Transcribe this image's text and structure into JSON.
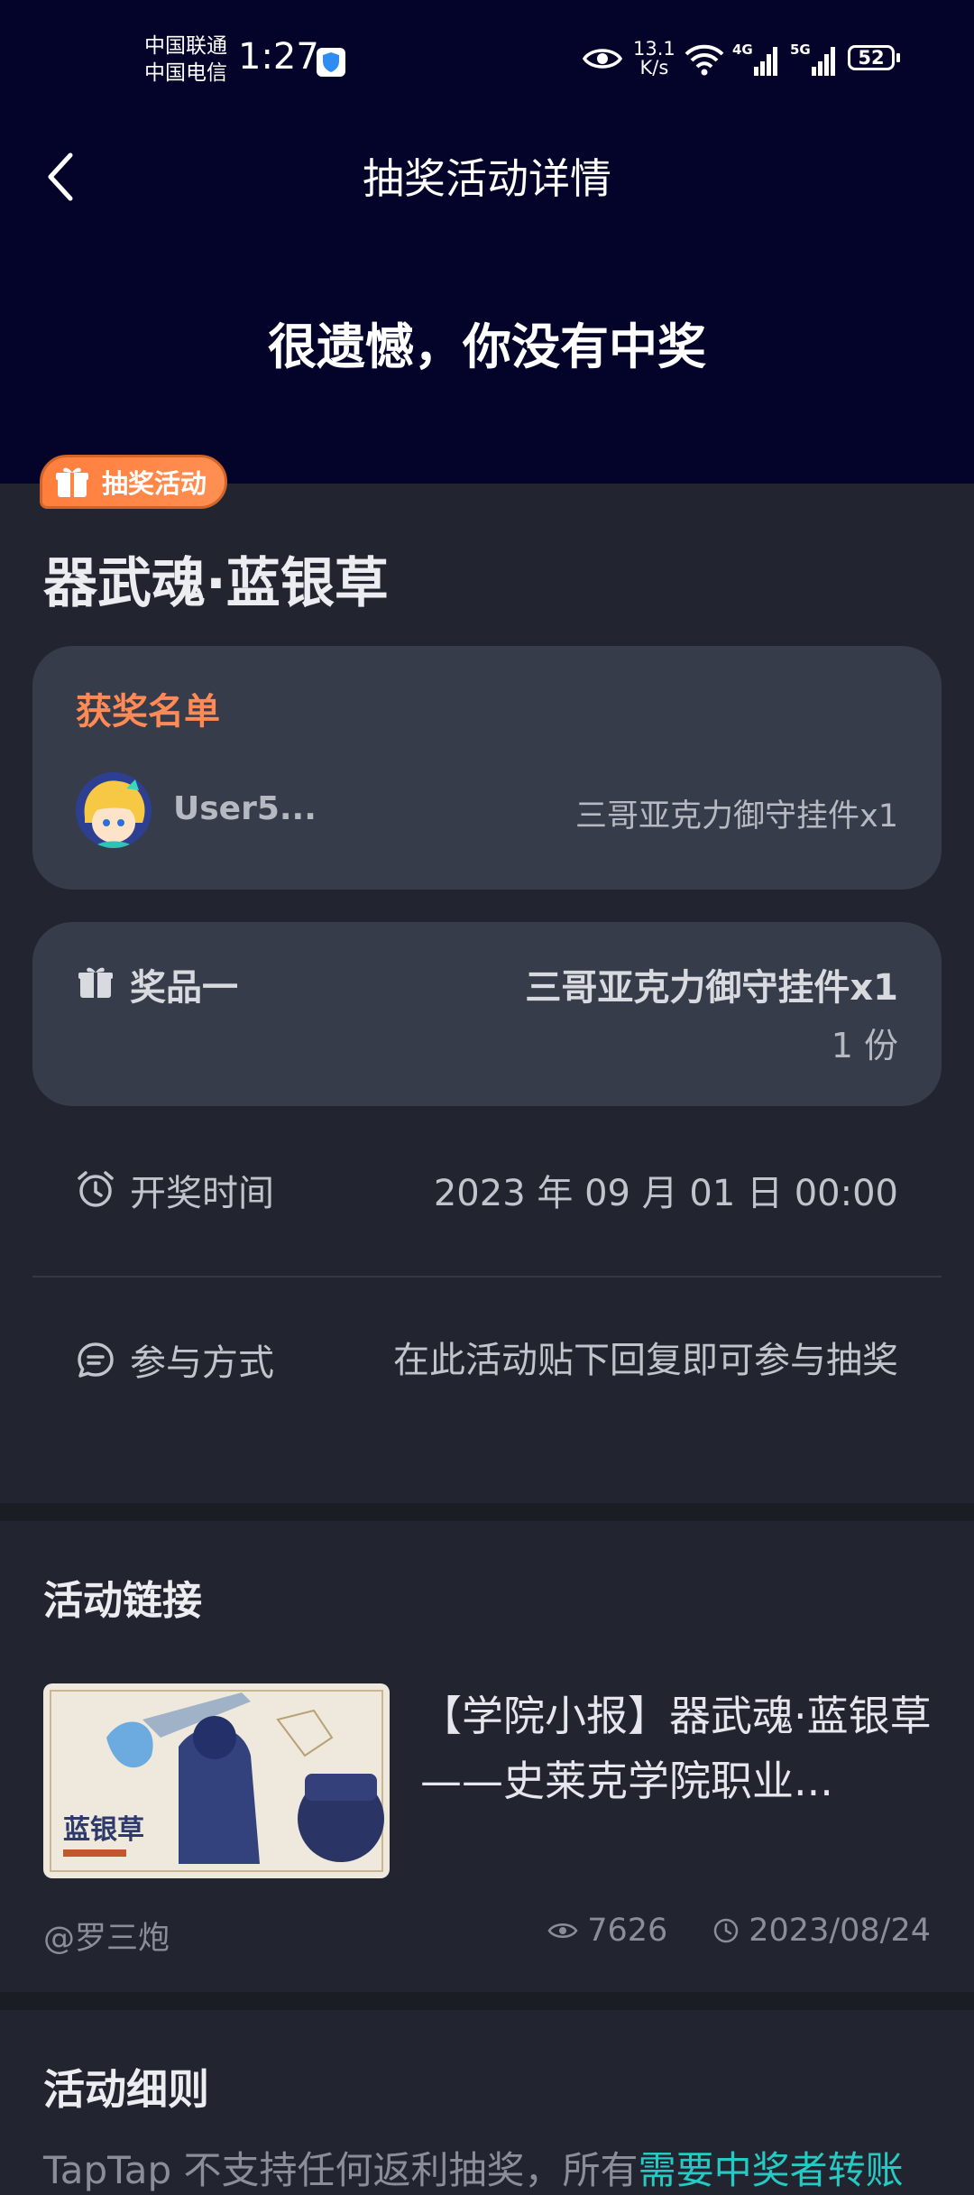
{
  "status_bar": {
    "carrier_1": "中国联通",
    "carrier_2": "中国电信",
    "time": "1:27",
    "net_speed_value": "13.1",
    "net_speed_unit": "K/s",
    "signal_1": "4G",
    "signal_2": "5G",
    "battery": "52"
  },
  "header": {
    "title": "抽奖活动详情",
    "result": "很遗憾，你没有中奖"
  },
  "activity": {
    "badge": "抽奖活动",
    "title": "器武魂·蓝银草"
  },
  "winners": {
    "heading": "获奖名单",
    "items": [
      {
        "name": "User5...",
        "prize": "三哥亚克力御守挂件x1"
      }
    ]
  },
  "prize": {
    "label": "奖品一",
    "name": "三哥亚克力御守挂件x1",
    "quantity": "1 份"
  },
  "draw_time": {
    "label": "开奖时间",
    "value": "2023 年 09 月 01 日 00:00"
  },
  "participation": {
    "label": "参与方式",
    "value": "在此活动贴下回复即可参与抽奖"
  },
  "links": {
    "heading": "活动链接",
    "items": [
      {
        "title": "【学院小报】器武魂·蓝银草——史莱克学院职业...",
        "author": "@罗三炮",
        "views": "7626",
        "date": "2023/08/24",
        "thumb_text": "蓝银草"
      }
    ]
  },
  "rules": {
    "heading": "活动细则",
    "text_plain": "TapTap 不支持任何返利抽奖，所有",
    "text_accent": "需要中奖者转账"
  },
  "colors": {
    "hero_bg": "#04042b",
    "page_bg": "#22252f",
    "card_bg": "#373c4a",
    "accent_orange": "#ff8a55",
    "accent_teal": "#26c9c3"
  }
}
